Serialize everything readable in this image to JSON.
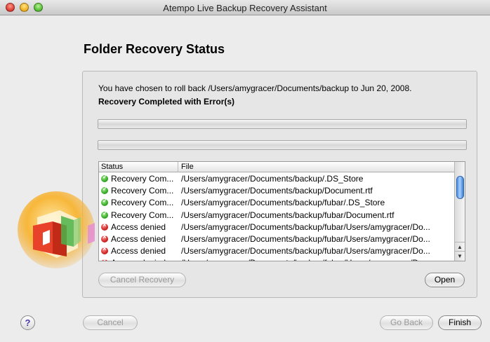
{
  "window": {
    "title": "Atempo Live Backup Recovery Assistant"
  },
  "page": {
    "heading": "Folder Recovery Status",
    "message": "You have chosen to roll back /Users/amygracer/Documents/backup to Jun 20, 2008.",
    "result": "Recovery Completed with Error(s)"
  },
  "table": {
    "columns": [
      "Status",
      "File"
    ],
    "rows": [
      {
        "state": "ok",
        "status": "Recovery Com...",
        "file": "/Users/amygracer/Documents/backup/.DS_Store"
      },
      {
        "state": "ok",
        "status": "Recovery Com...",
        "file": "/Users/amygracer/Documents/backup/Document.rtf"
      },
      {
        "state": "ok",
        "status": "Recovery Com...",
        "file": "/Users/amygracer/Documents/backup/fubar/.DS_Store"
      },
      {
        "state": "ok",
        "status": "Recovery Com...",
        "file": "/Users/amygracer/Documents/backup/fubar/Document.rtf"
      },
      {
        "state": "error",
        "status": "Access denied",
        "file": "/Users/amygracer/Documents/backup/fubar/Users/amygracer/Do..."
      },
      {
        "state": "error",
        "status": "Access denied",
        "file": "/Users/amygracer/Documents/backup/fubar/Users/amygracer/Do..."
      },
      {
        "state": "error",
        "status": "Access denied",
        "file": "/Users/amygracer/Documents/backup/fubar/Users/amygracer/Do..."
      },
      {
        "state": "error",
        "status": "Access denied",
        "file": "/Users/amygracer/Documents/backup/fubar/Users/amygracer/Do..."
      }
    ]
  },
  "buttons": {
    "cancel_recovery": "Cancel Recovery",
    "open": "Open",
    "help": "?",
    "cancel": "Cancel",
    "go_back": "Go Back",
    "finish": "Finish"
  },
  "colors": {
    "ok": "#2fa11f",
    "error": "#c81d1d",
    "logo": "#f5a623"
  },
  "icons": {
    "logo": "atempo-logo-icon",
    "status_ok": "check-circle-icon",
    "status_error": "x-circle-icon"
  }
}
